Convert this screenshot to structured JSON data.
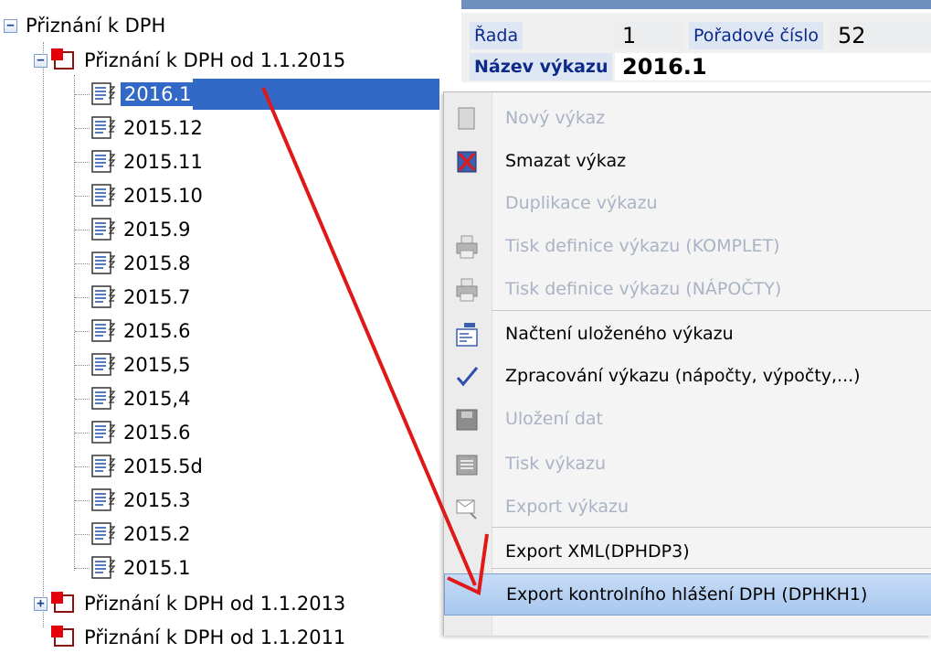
{
  "tree": {
    "root_label": "Přiznání k DPH",
    "group1_label": "Přiznání k DPH od 1.1.2015",
    "selected_label": "2016.1",
    "children": [
      "2015.12",
      "2015.11",
      "2015.10",
      "2015.9",
      "2015.8",
      "2015.7",
      "2015.6",
      "2015,5",
      "2015,4",
      "2015.6",
      "2015.5d",
      "2015.3",
      "2015.2",
      "2015.1"
    ],
    "group2_label": "Přiznání k DPH od 1.1.2013",
    "group3_label_partial": "Přiznání k DPH od 1.1.2011"
  },
  "header": {
    "rada_label": "Řada",
    "rada_value": "1",
    "poradove_label": "Pořadové číslo",
    "poradove_value": "52",
    "nazev_label": "Název výkazu",
    "nazev_value": "2016.1"
  },
  "menu": {
    "items": [
      {
        "label": "Nový výkaz",
        "icon": "new-doc-icon",
        "enabled": false
      },
      {
        "label": "Smazat výkaz",
        "icon": "delete-icon",
        "enabled": true
      },
      {
        "label": "Duplikace výkazu",
        "icon": "",
        "enabled": false
      },
      {
        "label": "Tisk definice výkazu (KOMPLET)",
        "icon": "printer-icon",
        "enabled": false
      },
      {
        "label": "Tisk definice výkazu (NÁPOČTY)",
        "icon": "printer-icon",
        "enabled": false
      },
      {
        "label": "Načtení uloženého výkazu",
        "icon": "load-icon",
        "enabled": true
      },
      {
        "label": "Zpracování výkazu (nápočty, výpočty,...)",
        "icon": "checkmark-icon",
        "enabled": true
      },
      {
        "label": "Uložení dat",
        "icon": "save-icon",
        "enabled": false
      },
      {
        "label": "Tisk výkazu",
        "icon": "print-report-icon",
        "enabled": false
      },
      {
        "label": "Export výkazu",
        "icon": "export-icon",
        "enabled": false
      },
      {
        "label": "Export XML(DPHDP3)",
        "icon": "",
        "enabled": true
      },
      {
        "label": "Export kontrolního hlášení DPH (DPHKH1)",
        "icon": "",
        "enabled": true,
        "highlighted": true
      }
    ]
  },
  "colors": {
    "selection": "#3269c6",
    "menu_highlight": "#b4cff0",
    "arrow": "#e01818",
    "folder_red": "#e4000a"
  }
}
